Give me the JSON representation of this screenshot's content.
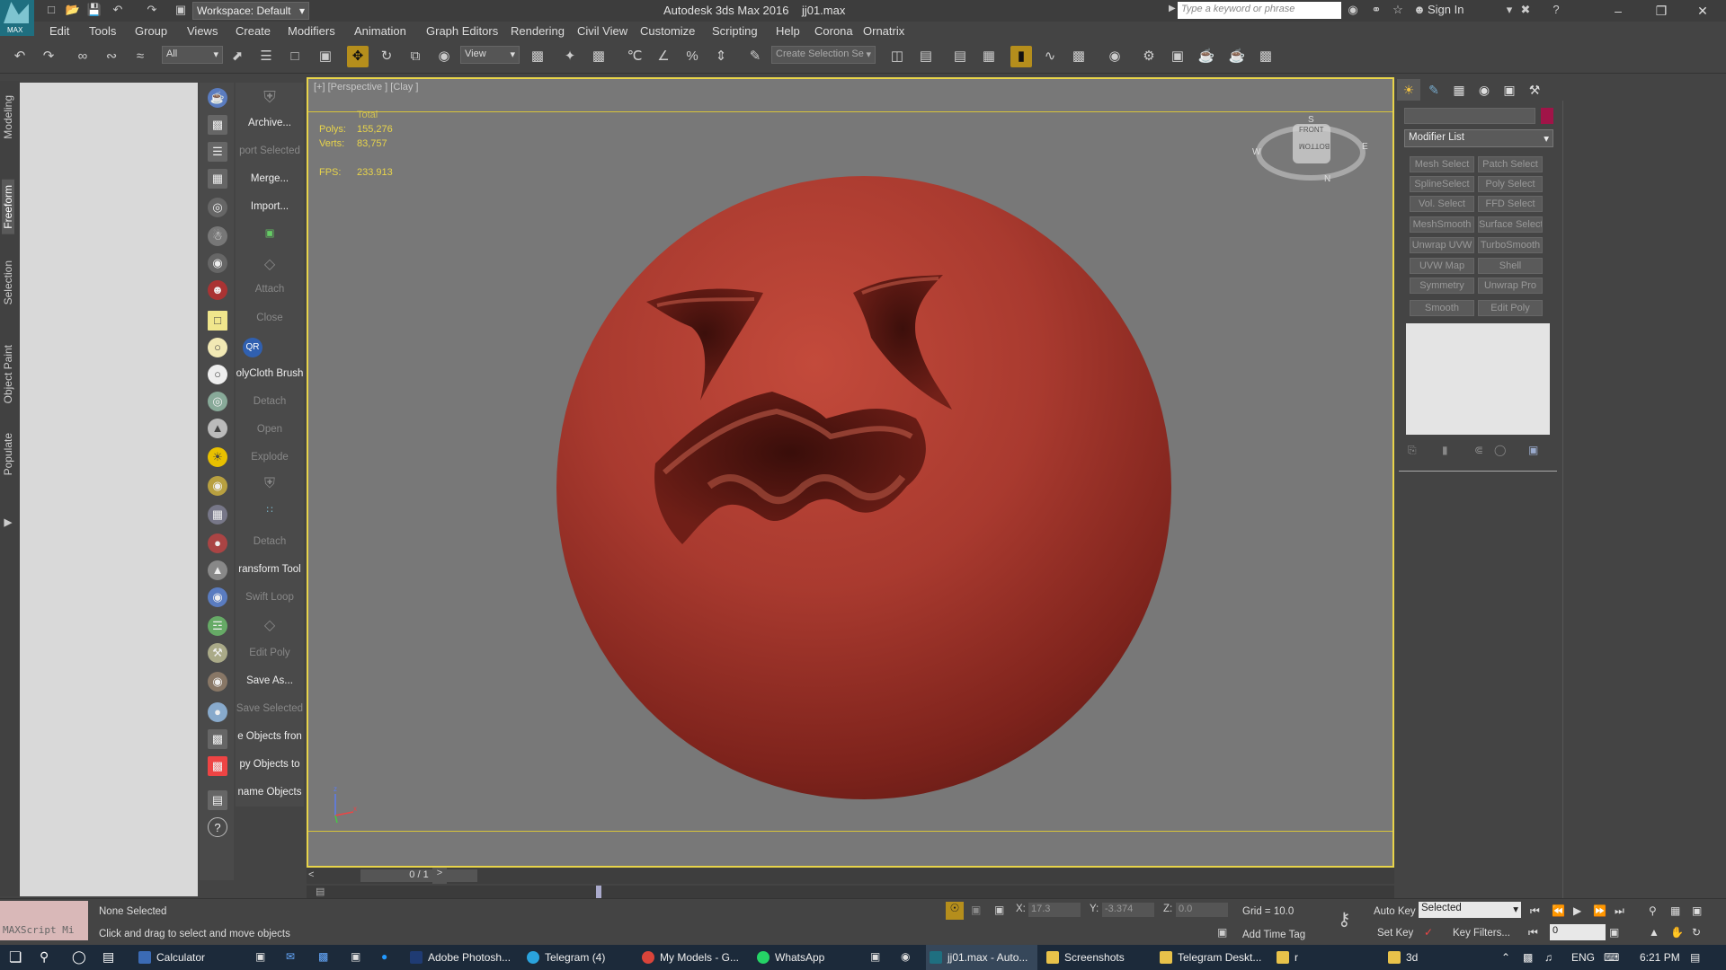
{
  "title": {
    "app_name": "Autodesk 3ds Max 2016",
    "file_name": "jj01.max",
    "workspace": "Workspace: Default",
    "search_placeholder": "Type a keyword or phrase",
    "sign_in": "Sign In",
    "logo_text": "MAX"
  },
  "menus": [
    "Edit",
    "Tools",
    "Group",
    "Views",
    "Create",
    "Modifiers",
    "Animation",
    "Graph Editors",
    "Rendering",
    "Civil View",
    "Customize",
    "Scripting",
    "Help",
    "Corona",
    "Ornatrix"
  ],
  "toolbar": {
    "filter_value": "All",
    "refcoord_value": "View",
    "named_selection_placeholder": "Create Selection Se"
  },
  "left_tabs": [
    "Modeling",
    "Freeform",
    "Selection",
    "Object Paint",
    "Populate"
  ],
  "quick_panel": {
    "items": [
      {
        "label": "Archive...",
        "enabled": true
      },
      {
        "label": "port Selected",
        "enabled": false
      },
      {
        "label": "Merge...",
        "enabled": true
      },
      {
        "label": "Import...",
        "enabled": true
      },
      {
        "label": "Attach",
        "enabled": false
      },
      {
        "label": "Close",
        "enabled": false
      },
      {
        "label": "olyCloth Brush",
        "enabled": true
      },
      {
        "label": "Detach",
        "enabled": false
      },
      {
        "label": "Open",
        "enabled": false
      },
      {
        "label": "Explode",
        "enabled": false
      },
      {
        "label": "Detach",
        "enabled": false
      },
      {
        "label": "ransform Tool",
        "enabled": true
      },
      {
        "label": "Swift Loop",
        "enabled": false
      },
      {
        "label": "Edit Poly",
        "enabled": false
      },
      {
        "label": "Save As...",
        "enabled": true
      },
      {
        "label": "Save Selected",
        "enabled": false
      },
      {
        "label": "e Objects fron",
        "enabled": true
      },
      {
        "label": "py Objects to",
        "enabled": true
      },
      {
        "label": "name Objects",
        "enabled": true
      }
    ],
    "qr_badge": "QR"
  },
  "viewport": {
    "label": "[+] [Perspective ] [Clay ]",
    "stats_header": "Total",
    "polys_label": "Polys:",
    "polys_value": "155,276",
    "verts_label": "Verts:",
    "verts_value": "83,757",
    "fps_label": "FPS:",
    "fps_value": "233.913",
    "viewcube_front": "FRONT",
    "viewcube_bottom": "BOTTOM",
    "compass_w": "W",
    "compass_e": "E",
    "compass_n": "N",
    "compass_s": "S",
    "axis_z": "z",
    "axis_x": "x"
  },
  "timeslider": {
    "readout": "0 / 1",
    "prev": "<",
    "next": ">"
  },
  "command_panel": {
    "modifier_list_label": "Modifier List",
    "modifier_buttons": [
      "Mesh Select",
      "Patch Select",
      "SplineSelect",
      "Poly Select",
      "Vol. Select",
      "FFD Select",
      "MeshSmooth",
      "Surface Select",
      "Unwrap UVW",
      "TurboSmooth",
      "UVW Map",
      "Shell",
      "Symmetry",
      "Unwrap Pro",
      "Smooth",
      "Edit Poly"
    ],
    "color_swatch": "#a01448"
  },
  "status": {
    "maxscript_label": "MAXScript Mi",
    "selection": "None Selected",
    "prompt": "Click and drag to select and move objects",
    "x_label": "X:",
    "x_value": "17.3",
    "y_label": "Y:",
    "y_value": "-3.374",
    "z_label": "Z:",
    "z_value": "0.0",
    "grid": "Grid = 10.0",
    "add_time_tag": "Add Time Tag",
    "auto_key": "Auto Key",
    "set_key": "Set Key",
    "selected_dropdown": "Selected",
    "key_filters": "Key Filters...",
    "frame_value": "0"
  },
  "taskbar": {
    "items": [
      {
        "label": "Calculator",
        "color": "#3b6bb5",
        "active": false
      },
      {
        "label": "Adobe Photosh...",
        "color": "#1f3b73",
        "active": false
      },
      {
        "label": "Telegram (4)",
        "color": "#2aa3dd",
        "active": false
      },
      {
        "label": "My Models - G...",
        "color": "#d9443a",
        "active": false
      },
      {
        "label": "WhatsApp",
        "color": "#25d366",
        "active": false
      },
      {
        "label": "jj01.max - Auto...",
        "color": "#1f6f80",
        "active": true
      },
      {
        "label": "Screenshots",
        "color": "#e8c24a",
        "active": false
      },
      {
        "label": "Telegram Deskt...",
        "color": "#e8c24a",
        "active": false
      },
      {
        "label": "r",
        "color": "#e8c24a",
        "active": false
      },
      {
        "label": "3d",
        "color": "#e8c24a",
        "active": false
      }
    ],
    "language": "ENG",
    "time": "6:21 PM"
  }
}
